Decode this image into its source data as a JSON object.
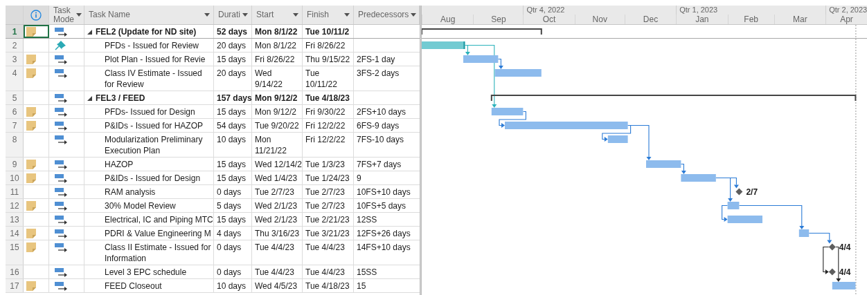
{
  "columns": [
    {
      "kind": "row-number"
    },
    {
      "kind": "indicators"
    },
    {
      "kind": "mode",
      "label": "Task\nMode"
    },
    {
      "kind": "name",
      "label": "Task Name"
    },
    {
      "kind": "duration",
      "label": "Durati"
    },
    {
      "kind": "start",
      "label": "Start"
    },
    {
      "kind": "finish",
      "label": "Finish"
    },
    {
      "kind": "predecessors",
      "label": "Predecessors"
    }
  ],
  "tasks": [
    {
      "id": "1",
      "kind": "summary",
      "note": true,
      "manually_scheduled": false,
      "name": "FEL2 (Update for ND site)",
      "duration": "52 days",
      "start": "Mon 8/1/22",
      "finish": "Tue 10/11/2",
      "selected": true,
      "expanded": true,
      "children": [
        {
          "id": "2",
          "kind": "task",
          "note": false,
          "manually_scheduled": true,
          "name": "PFDs - Issued for Review",
          "duration": "20 days",
          "start": "Mon 8/1/22",
          "finish": "Fri 8/26/22",
          "selected": false
        },
        {
          "id": "3",
          "kind": "task",
          "note": true,
          "manually_scheduled": false,
          "name": "Plot Plan - Issued for Revie",
          "duration": "15 days",
          "start": "Fri 8/26/22",
          "finish": "Thu 9/15/22",
          "predecessors": "2FS-1 day",
          "selected": false
        },
        {
          "id": "4",
          "kind": "task",
          "note": true,
          "manually_scheduled": false,
          "name": "Class IV Estimate - Issued\nfor Review",
          "duration": "20 days",
          "start": "Wed\n9/14/22",
          "finish": "Tue\n10/11/22",
          "predecessors": "3FS-2 days",
          "selected": false
        }
      ]
    },
    {
      "id": "5",
      "kind": "summary",
      "note": false,
      "manually_scheduled": false,
      "name": "FEL3 / FEED",
      "duration": "157 days",
      "start": "Mon 9/12/2",
      "finish": "Tue 4/18/23",
      "selected": false,
      "expanded": true,
      "children": [
        {
          "id": "6",
          "kind": "task",
          "note": true,
          "manually_scheduled": false,
          "name": "PFDs- Issued for Design",
          "duration": "15 days",
          "start": "Mon 9/12/2",
          "finish": "Fri 9/30/22",
          "predecessors": "2FS+10 days",
          "selected": false
        },
        {
          "id": "7",
          "kind": "task",
          "note": true,
          "manually_scheduled": false,
          "name": "P&IDs - Issued for HAZOP",
          "duration": "54 days",
          "start": "Tue 9/20/22",
          "finish": "Fri 12/2/22",
          "predecessors": "6FS-9 days",
          "selected": false
        },
        {
          "id": "8",
          "kind": "task",
          "note": false,
          "manually_scheduled": false,
          "name": "Modularization Preliminary\nExecution Plan",
          "duration": "10 days",
          "start": "Mon\n11/21/22",
          "finish": "Fri 12/2/22",
          "predecessors": "7FS-10 days",
          "selected": false
        },
        {
          "id": "9",
          "kind": "task",
          "note": true,
          "manually_scheduled": false,
          "name": "HAZOP",
          "duration": "15 days",
          "start": "Wed 12/14/2",
          "finish": "Tue 1/3/23",
          "predecessors": "7FS+7 days",
          "selected": false
        },
        {
          "id": "10",
          "kind": "task",
          "note": true,
          "manually_scheduled": false,
          "name": "P&IDs - Issued for Design",
          "duration": "15 days",
          "start": "Wed 1/4/23",
          "finish": "Tue 1/24/23",
          "predecessors": "9",
          "selected": false
        },
        {
          "id": "11",
          "kind": "milestone",
          "note": false,
          "manually_scheduled": false,
          "name": "RAM analysis",
          "duration": "0 days",
          "start": "Tue 2/7/23",
          "finish": "Tue 2/7/23",
          "predecessors": "10FS+10 days",
          "bar_label": "2/7",
          "selected": false
        },
        {
          "id": "12",
          "kind": "task",
          "note": true,
          "manually_scheduled": false,
          "name": "30% Model Review",
          "duration": "5 days",
          "start": "Wed 2/1/23",
          "finish": "Tue 2/7/23",
          "predecessors": "10FS+5 days",
          "selected": false
        },
        {
          "id": "13",
          "kind": "task",
          "note": false,
          "manually_scheduled": false,
          "name": "Electrical, IC and Piping MTC",
          "duration": "15 days",
          "start": "Wed 2/1/23",
          "finish": "Tue 2/21/23",
          "predecessors": "12SS",
          "selected": false
        },
        {
          "id": "14",
          "kind": "task",
          "note": true,
          "manually_scheduled": false,
          "name": "PDRI & Value Engineering M",
          "duration": "4 days",
          "start": "Thu 3/16/23",
          "finish": "Tue 3/21/23",
          "predecessors": "12FS+26 days",
          "selected": false
        },
        {
          "id": "15",
          "kind": "milestone",
          "note": true,
          "manually_scheduled": false,
          "name": "Class II Estimate - Issued for\nInformation",
          "duration": "0 days",
          "start": "Tue 4/4/23",
          "finish": "Tue 4/4/23",
          "predecessors": "14FS+10 days",
          "bar_label": "4/4",
          "selected": false
        },
        {
          "id": "16",
          "kind": "milestone",
          "note": false,
          "manually_scheduled": false,
          "name": "Level 3 EPC schedule",
          "duration": "0 days",
          "start": "Tue 4/4/23",
          "finish": "Tue 4/4/23",
          "predecessors": "15SS",
          "bar_label": "4/4",
          "selected": false
        },
        {
          "id": "17",
          "kind": "task",
          "note": true,
          "manually_scheduled": false,
          "name": "FEED Closeout",
          "duration": "10 days",
          "start": "Wed 4/5/23",
          "finish": "Tue 4/18/23",
          "predecessors": "15",
          "selected": false
        }
      ]
    }
  ],
  "timescale": {
    "quarters": [
      {
        "label": "Qtr 4, 2022"
      },
      {
        "label": "Qtr 1, 2023"
      },
      {
        "label": "Qtr 2, 2023"
      }
    ],
    "months": [
      {
        "label": "Aug"
      },
      {
        "label": "Sep"
      },
      {
        "label": "Oct"
      },
      {
        "label": "Nov"
      },
      {
        "label": "Dec"
      },
      {
        "label": "Jan"
      },
      {
        "label": "Feb"
      },
      {
        "label": "Mar"
      },
      {
        "label": "Apr"
      }
    ]
  }
}
